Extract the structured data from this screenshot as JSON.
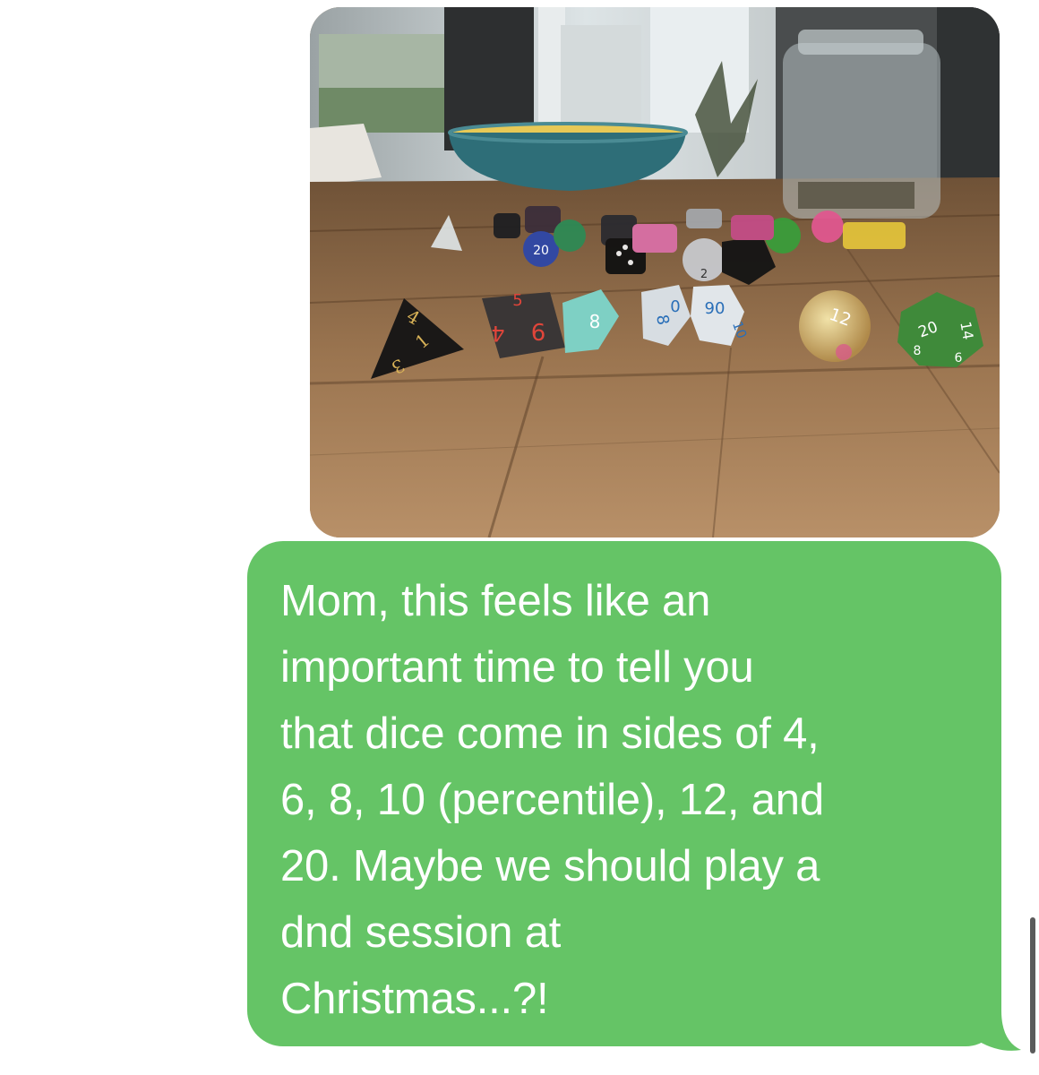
{
  "conversation": {
    "attachment": {
      "type": "photo",
      "die_faces": {
        "d4_labels": [
          "4",
          "1",
          "3"
        ],
        "d6_labels": [
          "5",
          "6",
          "4"
        ],
        "d8_label": "8",
        "d10_labels": [
          "8",
          "0"
        ],
        "d10_percentile_labels": [
          "90",
          "10"
        ],
        "d12_label": "12",
        "d20_labels": [
          "20",
          "14",
          "8",
          "6"
        ],
        "small_dice_labels": [
          "20",
          "2"
        ]
      }
    },
    "message": {
      "direction": "sent",
      "text": "Mom, this feels like an\nimportant time to tell you\nthat dice come in sides of 4,\n6, 8, 10 (percentile), 12, and\n20. Maybe we should play a\ndnd session at\nChristmas...?!"
    }
  },
  "colors": {
    "sent_bubble": "#65c466",
    "bubble_text": "#ffffff",
    "background": "#ffffff"
  },
  "icons": {
    "scroll_indicator": "scroll-indicator-bar"
  }
}
